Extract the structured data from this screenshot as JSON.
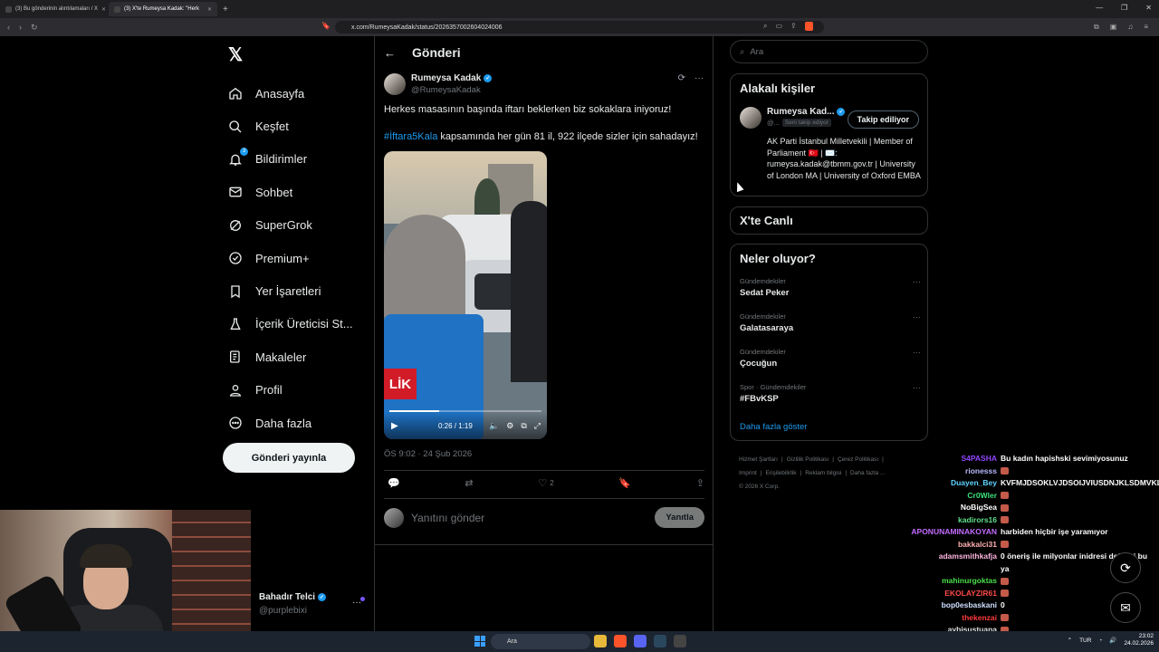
{
  "browser": {
    "tabs": [
      {
        "label": "(3) Bu gönderinin alıntılamaları / X",
        "active": false
      },
      {
        "label": "(3) X'te Rumeysa Kadak: \"Herk",
        "active": true
      }
    ],
    "url": "x.com/RumeysaKadak/status/2026357002604024006"
  },
  "sidebar": {
    "items": [
      {
        "label": "Anasayfa",
        "icon": "home-icon"
      },
      {
        "label": "Keşfet",
        "icon": "search-icon"
      },
      {
        "label": "Bildirimler",
        "icon": "bell-icon",
        "badge": "3"
      },
      {
        "label": "Sohbet",
        "icon": "mail-icon"
      },
      {
        "label": "SuperGrok",
        "icon": "grok-icon"
      },
      {
        "label": "Premium+",
        "icon": "premium-icon"
      },
      {
        "label": "Yer İşaretleri",
        "icon": "bookmark-icon"
      },
      {
        "label": "İçerik Üreticisi St...",
        "icon": "flask-icon"
      },
      {
        "label": "Makaleler",
        "icon": "article-icon"
      },
      {
        "label": "Profil",
        "icon": "person-icon"
      },
      {
        "label": "Daha fazla",
        "icon": "more-circle-icon"
      }
    ],
    "post_button": "Gönderi yayınla",
    "account": {
      "name": "Bahadır Telci",
      "handle": "@purplebixi"
    }
  },
  "post": {
    "header_title": "Gönderi",
    "author_name": "Rumeysa Kadak",
    "author_handle": "@RumeysaKadak",
    "text1": "Herkes masasının başında iftarı beklerken biz sokaklara iniyoruz!",
    "hashtag": "#İftara5Kala",
    "text2": " kapsamında her gün 81 il, 922 ilçede sizler için sahadayız!",
    "video_time": "0:26 / 1:19",
    "video_banner": "LİK",
    "video_progress": 0.33,
    "timestamp": "ÖS 9:02 · 24 Şub 2026",
    "like_count": "2",
    "reply_placeholder": "Yanıtını gönder",
    "reply_button": "Yanıtla"
  },
  "right": {
    "search_placeholder": "Ara",
    "related_title": "Alakalı kişiler",
    "related_name": "Rumeysa Kad...",
    "related_handle": "@...",
    "follows_you": "Seni takip ediyor",
    "following_button": "Takip ediliyor",
    "bio": "AK Parti İstanbul Milletvekili | Member of Parliament 🇹🇷 | ✉️: rumeysa.kadak@tbmm.gov.tr | University of London MA | University of Oxford EMBA",
    "live_title": "X'te Canlı",
    "trends_title": "Neler oluyor?",
    "trends": [
      {
        "category": "Gündemdekiler",
        "title": "Sedat Peker"
      },
      {
        "category": "Gündemdekiler",
        "title": "Galatasaraya"
      },
      {
        "category": "Gündemdekiler",
        "title": "Çocuğun"
      },
      {
        "category": "Spor · Gündemdekiler",
        "title": "#FBvKSP"
      }
    ],
    "show_more": "Daha fazla göster",
    "footer_links": [
      "Hizmet Şartları",
      "|",
      "Gizlilik Politikası",
      "|",
      "Çerez Politikası",
      "|",
      "Imprint",
      "|",
      "Erişilebilirlik",
      "|",
      "Reklam bilgisi",
      "|",
      "Daha fazla ...",
      "© 2026 X Corp."
    ]
  },
  "chat": [
    {
      "user": "S4PASHA",
      "color": "#9146ff",
      "msg": "Bu kadın hapishski sevimiyosunuz"
    },
    {
      "user": "rionesss",
      "color": "#b9b9ff",
      "msg": "",
      "emote": true
    },
    {
      "user": "Duayen_Bey",
      "color": "#5fd3ff",
      "msg": "KVFMJDSOKLVJDSOIJVIUSDNJKLSDMVKLDSMLVKDSMŞL"
    },
    {
      "user": "Cr0Wler",
      "color": "#3de07a",
      "msg": "",
      "emote": true
    },
    {
      "user": "NoBigSea",
      "color": "#ffffff",
      "msg": "",
      "emote": true
    },
    {
      "user": "kadirors16",
      "color": "#5fe08a",
      "msg": "",
      "emote": true
    },
    {
      "user": "APONUNAMINAKOYAN",
      "color": "#c56cff",
      "msg": "harbiden hiçbir işe yaramıyor"
    },
    {
      "user": "bakkalci31",
      "color": "#ffb0b0",
      "msg": "",
      "emote": true
    },
    {
      "user": "adamsmithkafja",
      "color": "#ffb6e0",
      "msg": "0 öneriş ile milyonlar inidresi değilmi bu ya"
    },
    {
      "user": "mahinurgoktas",
      "color": "#4be04b",
      "msg": "",
      "emote": true
    },
    {
      "user": "EKOLAYZIR61",
      "color": "#ff4a4a",
      "msg": "",
      "emote": true
    },
    {
      "user": "bop0esbaskani",
      "color": "#cfe0ff",
      "msg": "0"
    },
    {
      "user": "thekenzai",
      "color": "#ff3a3a",
      "msg": "",
      "emote": true
    },
    {
      "user": "aybisustuana",
      "color": "#e0e0e0",
      "msg": "",
      "emote": true
    }
  ],
  "taskbar": {
    "search": "Ara",
    "lang": "TUR",
    "time": "23:02",
    "date": "24.02.2026"
  }
}
